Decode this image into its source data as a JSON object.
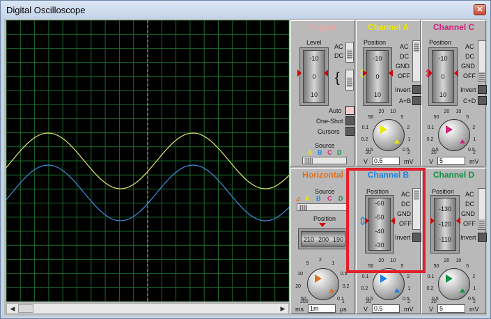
{
  "window": {
    "title": "Digital Oscilloscope",
    "close_glyph": "✕"
  },
  "scrollbar": {
    "left_glyph": "◀",
    "right_glyph": "▶"
  },
  "trigger": {
    "title": "Trigger",
    "title_color": "#e8a8a8",
    "level_label": "Level",
    "level_ticks": [
      "-10",
      "0",
      "10"
    ],
    "coupling": [
      "AC",
      "DC"
    ],
    "buttons": [
      "Auto",
      "One-Shot",
      "Cursors"
    ],
    "source_label": "Source",
    "sources": [
      "A",
      "B",
      "C",
      "D"
    ]
  },
  "channel_a": {
    "title": "Channel A",
    "color": "#e8e800",
    "position_label": "Position",
    "position_ticks": [
      "-10",
      "0",
      "10"
    ],
    "coupling": [
      "AC",
      "DC",
      "GND",
      "OFF"
    ],
    "invert_label": "Invert",
    "sum_label": "A+B",
    "dial_ticks": [
      "0.5",
      "0.2",
      "0.1",
      "50",
      "20",
      "10",
      "5",
      "2",
      "1",
      "0.5"
    ],
    "value": "0.5",
    "unit_left": "V",
    "unit_right": "mV",
    "range_left": "20",
    "range_right": "2"
  },
  "channel_c": {
    "title": "Channel C",
    "color": "#d0207a",
    "position_label": "Position",
    "position_ticks": [
      "-10",
      "0",
      "10"
    ],
    "coupling": [
      "AC",
      "DC",
      "GND",
      "OFF"
    ],
    "invert_label": "Invert",
    "sum_label": "C+D",
    "dial_ticks": [
      "0.5",
      "0.2",
      "0.1",
      "50",
      "20",
      "10",
      "5",
      "2",
      "1",
      "0.5"
    ],
    "value": "5",
    "unit_left": "V",
    "unit_right": "mV",
    "range_left": "20",
    "range_right": "2"
  },
  "horizontal": {
    "title": "Horizontal",
    "color": "#e07020",
    "source_label": "Source",
    "sources": [
      "A",
      "B",
      "C",
      "D"
    ],
    "position_label": "Position",
    "position_ticks": [
      "210",
      "200",
      "190"
    ],
    "dial_ticks": [
      "50",
      "20",
      "10",
      "5",
      "2",
      "1",
      "0.5",
      "0.2",
      "0.1"
    ],
    "value": "1m",
    "unit_left": "ms",
    "unit_right": "µs",
    "range_left": "200",
    "range_right": "1"
  },
  "channel_b": {
    "title": "Channel B",
    "color": "#2080e0",
    "position_label": "Position",
    "position_ticks": [
      "-60",
      "-50",
      "-40",
      "-30"
    ],
    "coupling": [
      "AC",
      "DC",
      "GND",
      "OFF"
    ],
    "invert_label": "Invert",
    "dial_ticks": [
      "0.5",
      "0.2",
      "0.1",
      "50",
      "20",
      "10",
      "5",
      "2",
      "1",
      "0.5"
    ],
    "value": "0.5",
    "unit_left": "V",
    "unit_right": "mV",
    "range_left": "20",
    "range_right": "2"
  },
  "channel_d": {
    "title": "Channel D",
    "color": "#109040",
    "position_label": "Position",
    "position_ticks": [
      "-130",
      "-120",
      "-110"
    ],
    "coupling": [
      "AC",
      "DC",
      "GND",
      "OFF"
    ],
    "invert_label": "Invert",
    "dial_ticks": [
      "0.5",
      "0.2",
      "0.1",
      "50",
      "20",
      "10",
      "5",
      "2",
      "1",
      "0.5"
    ],
    "value": "5",
    "unit_left": "V",
    "unit_right": "mV",
    "range_left": "20",
    "range_right": "2"
  },
  "display": {
    "grid_color": "#1c6b2c",
    "trace_a_color": "#e8e870",
    "trace_b_color": "#3f8fe0"
  }
}
